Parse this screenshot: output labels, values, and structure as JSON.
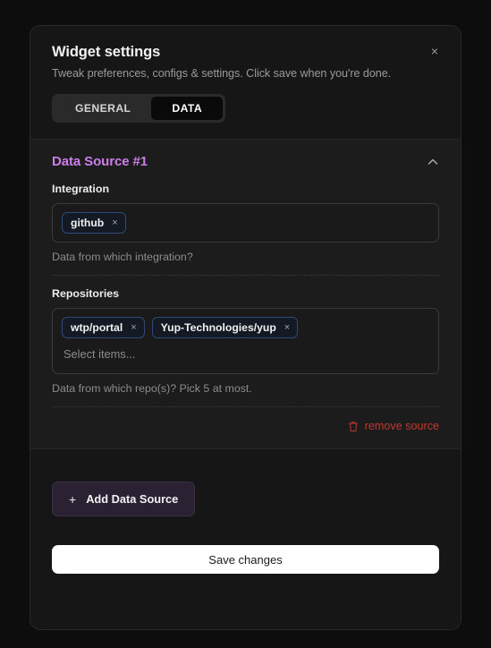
{
  "dialog": {
    "title": "Widget settings",
    "subtitle": "Tweak preferences, configs & settings. Click save when you're done.",
    "close_label": "×"
  },
  "tabs": [
    {
      "label": "GENERAL",
      "active": false
    },
    {
      "label": "DATA",
      "active": true
    }
  ],
  "data_source": {
    "title": "Data Source #1",
    "collapse_state": "expanded",
    "integration": {
      "label": "Integration",
      "chips": [
        {
          "label": "github",
          "remove": "×"
        }
      ],
      "helper": "Data from which integration?"
    },
    "repositories": {
      "label": "Repositories",
      "chips": [
        {
          "label": "wtp/portal",
          "remove": "×"
        },
        {
          "label": "Yup-Technologies/yup",
          "remove": "×"
        }
      ],
      "placeholder": "Select items...",
      "helper": "Data from which repo(s)? Pick 5 at most."
    },
    "remove_label": "remove source"
  },
  "footer": {
    "add_label": "Add Data Source",
    "add_plus": "+",
    "save_label": "Save changes"
  },
  "colors": {
    "accent_purple": "#cc7ee8",
    "danger_red": "#c0392f",
    "chip_border_blue": "#2f4a78",
    "page_bg": "#0d0d0d",
    "modal_bg": "#161616",
    "section_bg": "#1c1c1c"
  }
}
